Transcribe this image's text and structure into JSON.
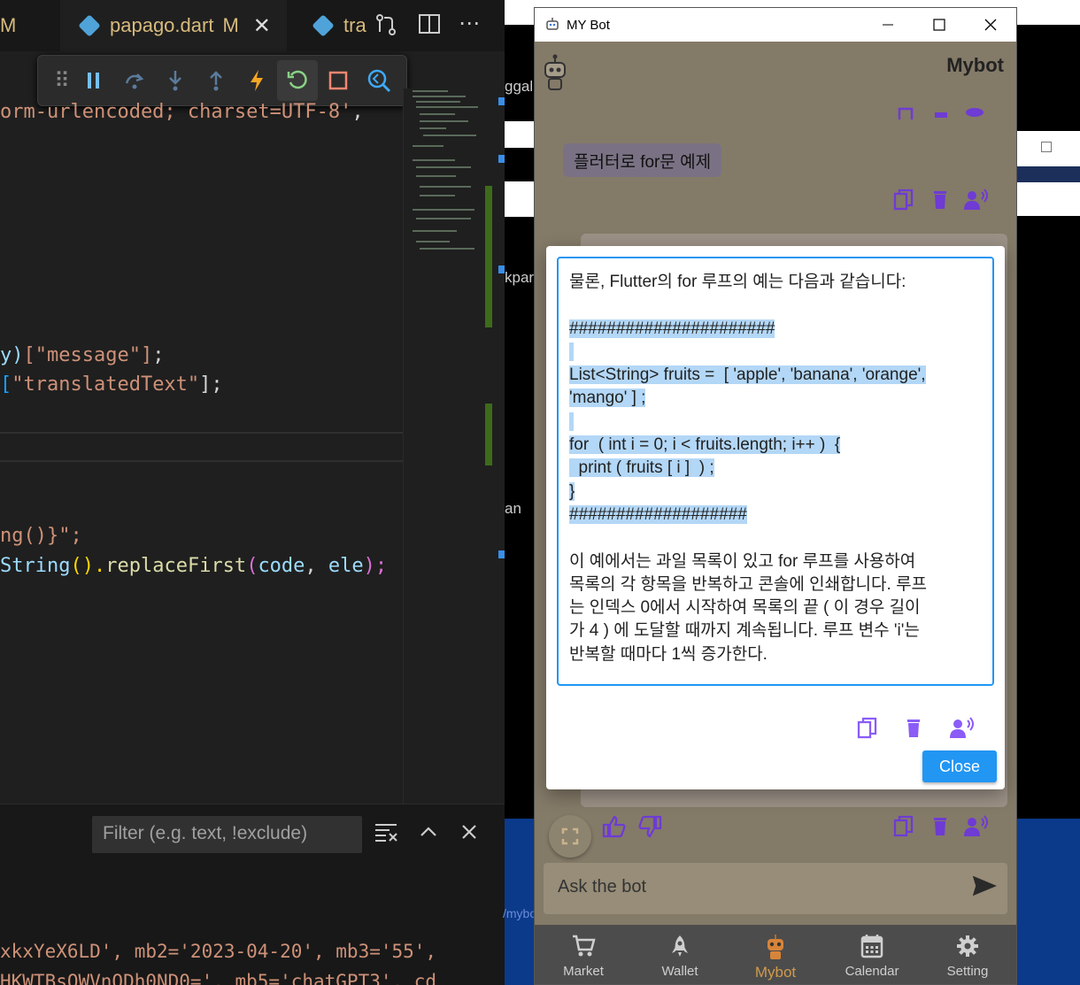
{
  "vscode": {
    "tabs": [
      {
        "label": "M"
      },
      {
        "label": "papago.dart",
        "badge": "M"
      },
      {
        "label": "tra"
      }
    ],
    "code_lines": {
      "line1_str": "orm-urlencoded; charset=UTF-8'",
      "line1_tail": ",",
      "line2_pre": "y)",
      "line2_str": "[\"message\"]",
      "line2_tail": ";",
      "line3_pre": "[",
      "line3_str": "\"translatedText\"",
      "line3_tail": "];",
      "line4": "ng()}\";",
      "line5_a": "String",
      "line5_b": "().",
      "line5_c": "replaceFirst",
      "line5_d": "(",
      "line5_e": "code",
      "line5_f": ", ",
      "line5_g": "ele",
      "line5_h": ");",
      "bottom1": "xkxYeX6LD', mb2='2023-04-20', mb3='55',",
      "bottom2": "HKWTBsQWVnODh0ND0=', mb5='chatGPT3', cd"
    },
    "filter_placeholder": "Filter (e.g. text, !exclude)",
    "bg_fragments": [
      "ggal",
      "kpar",
      "an",
      "/mybo"
    ]
  },
  "mybot_window": {
    "title": "MY Bot",
    "appbar_title": "Mybot",
    "user_message": "플러터로 for문 예제",
    "dialog": {
      "lines": [
        {
          "text": "물론, Flutter의 for 루프의 예는 다음과 같습니다:",
          "selected": false
        },
        {
          "text": "",
          "selected": false
        },
        {
          "text": "######################",
          "selected": true
        },
        {
          "text": " ",
          "selected": true
        },
        {
          "text": "List<String> fruits =  [ 'apple', 'banana', 'orange',",
          "selected": true
        },
        {
          "text": "'mango' ] ;",
          "selected": true
        },
        {
          "text": " ",
          "selected": true
        },
        {
          "text": "for  ( int i = 0; i < fruits.length; i++ )  {",
          "selected": true
        },
        {
          "text": "  print ( fruits [ i ]  ) ;",
          "selected": true
        },
        {
          "text": "}",
          "selected": true
        },
        {
          "text": "###################",
          "selected": true
        },
        {
          "text": "",
          "selected": false
        },
        {
          "text": "이 예에서는 과일 목록이 있고 for 루프를 사용하여",
          "selected": false
        },
        {
          "text": "목록의 각 항목을 반복하고 콘솔에 인쇄합니다. 루프",
          "selected": false
        },
        {
          "text": "는 인덱스 0에서 시작하여 목록의 끝 ( 이 경우 길이",
          "selected": false
        },
        {
          "text": "가 4 ) 에 도달할 때까지 계속됩니다. 루프 변수 'i'는",
          "selected": false
        },
        {
          "text": "반복할 때마다 1씩 증가한다.",
          "selected": false
        }
      ],
      "close_label": "Close"
    },
    "input_placeholder": "Ask the bot",
    "nav": [
      {
        "label": "Market",
        "icon": "cart-icon"
      },
      {
        "label": "Wallet",
        "icon": "rocket-icon"
      },
      {
        "label": "Mybot",
        "icon": "robot-icon",
        "active": true
      },
      {
        "label": "Calendar",
        "icon": "calendar-icon"
      },
      {
        "label": "Setting",
        "icon": "gear-icon"
      }
    ],
    "colors": {
      "accent": "#2196f3",
      "icon_purple": "#7b3fe4",
      "nav_active": "#d09a4a"
    }
  }
}
